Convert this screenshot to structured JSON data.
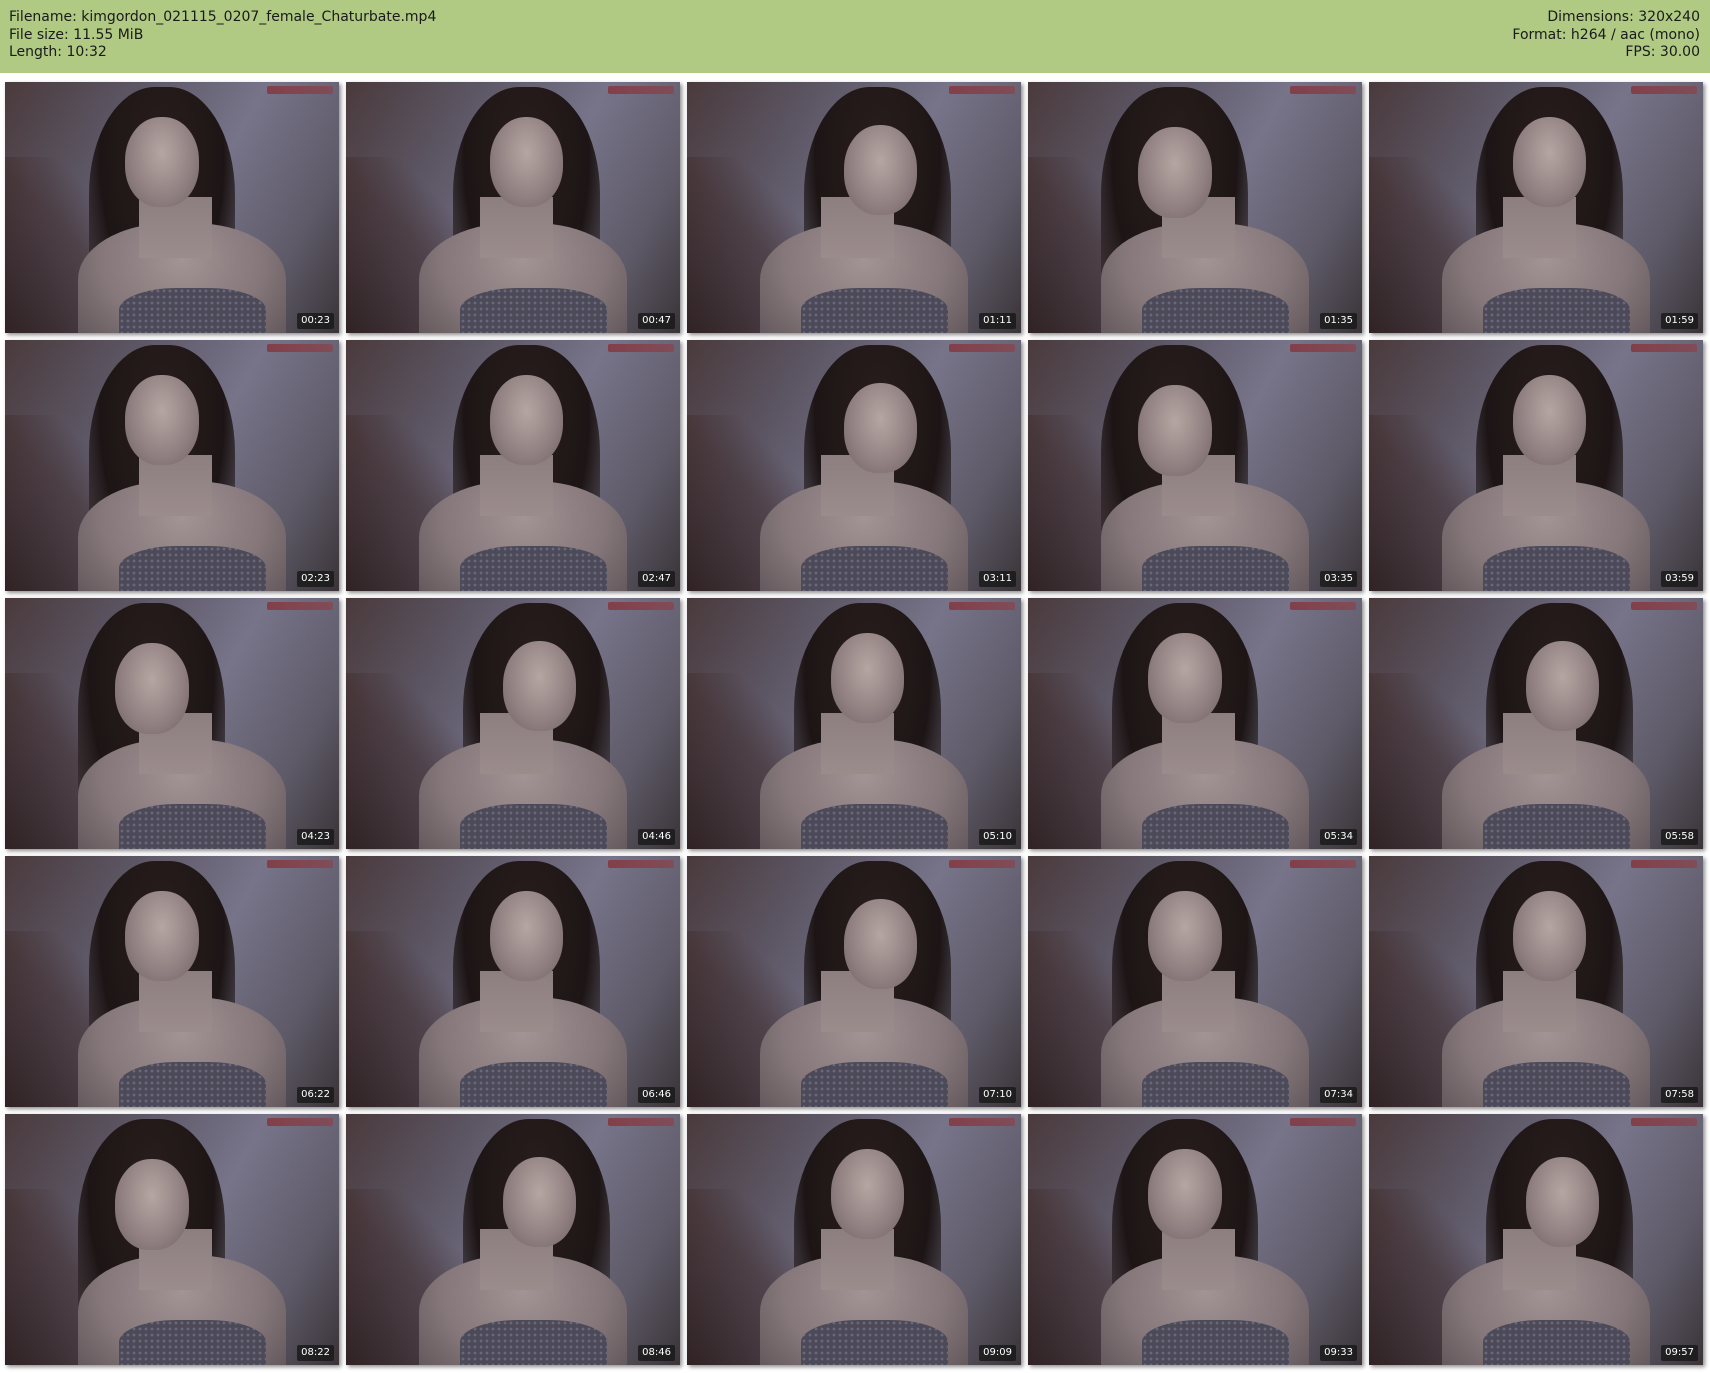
{
  "header": {
    "filename_line": "Filename: kimgordon_021115_0207_female_Chaturbate.mp4",
    "filesize_line": "File size: 11.55 MiB",
    "length_line": "Length: 10:32",
    "dimensions_line": "Dimensions: 320x240",
    "format_line": "Format: h264 / aac (mono)",
    "fps_line": "FPS: 30.00"
  },
  "thumbnails": [
    {
      "timestamp": "00:23"
    },
    {
      "timestamp": "00:47"
    },
    {
      "timestamp": "01:11"
    },
    {
      "timestamp": "01:35"
    },
    {
      "timestamp": "01:59"
    },
    {
      "timestamp": "02:23"
    },
    {
      "timestamp": "02:47"
    },
    {
      "timestamp": "03:11"
    },
    {
      "timestamp": "03:35"
    },
    {
      "timestamp": "03:59"
    },
    {
      "timestamp": "04:23"
    },
    {
      "timestamp": "04:46"
    },
    {
      "timestamp": "05:10"
    },
    {
      "timestamp": "05:34"
    },
    {
      "timestamp": "05:58"
    },
    {
      "timestamp": "06:22"
    },
    {
      "timestamp": "06:46"
    },
    {
      "timestamp": "07:10"
    },
    {
      "timestamp": "07:34"
    },
    {
      "timestamp": "07:58"
    },
    {
      "timestamp": "08:22"
    },
    {
      "timestamp": "08:46"
    },
    {
      "timestamp": "09:09"
    },
    {
      "timestamp": "09:33"
    },
    {
      "timestamp": "09:57"
    }
  ],
  "colors": {
    "header_background": "#b0ca83",
    "timestamp_background": "#191919"
  }
}
